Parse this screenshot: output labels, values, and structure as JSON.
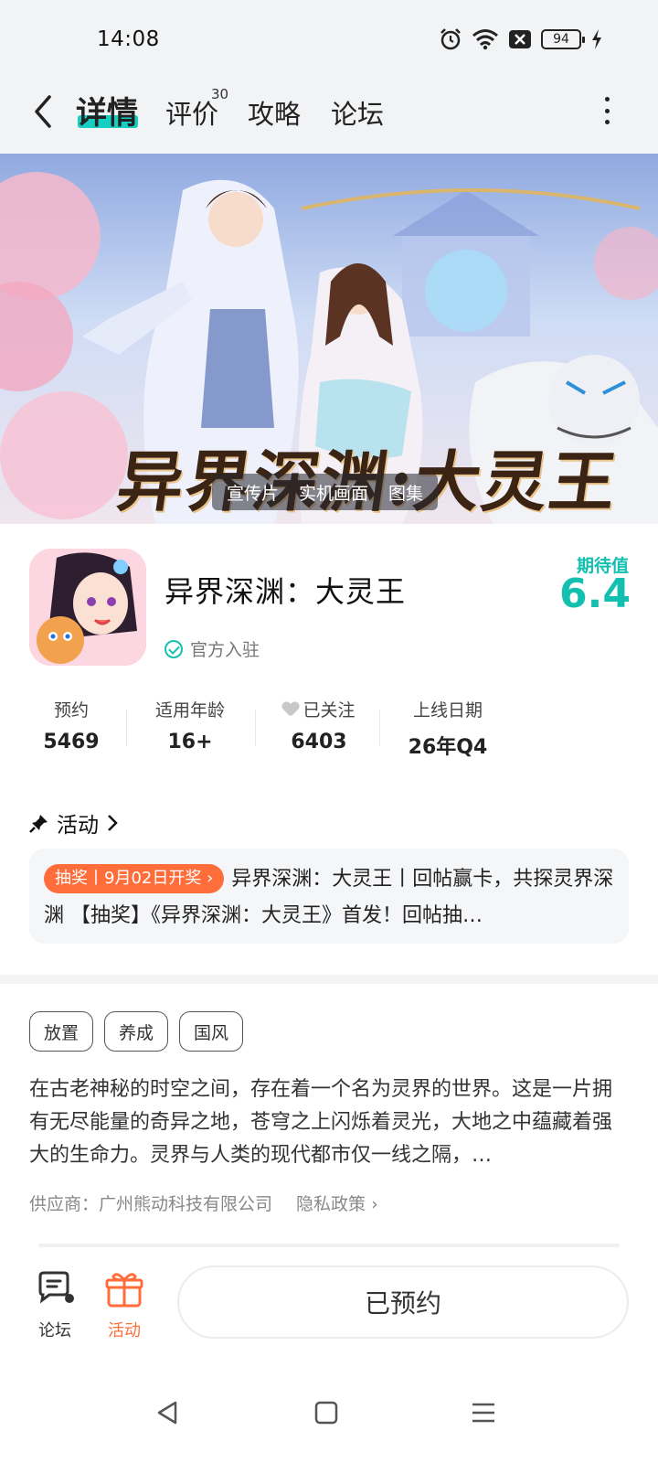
{
  "status_bar": {
    "time": "14:08",
    "battery": "94"
  },
  "nav": {
    "tabs": [
      {
        "label": "详情"
      },
      {
        "label": "评价",
        "badge": "30"
      },
      {
        "label": "攻略"
      },
      {
        "label": "论坛"
      }
    ]
  },
  "banner": {
    "title": "异界深渊:大灵王",
    "media_tabs": [
      "宣传片",
      "实机画面",
      "图集"
    ]
  },
  "app": {
    "name": "异界深渊：大灵王",
    "official": "官方入驻",
    "expect_label": "期待值",
    "expect_value": "6.4"
  },
  "stats": [
    {
      "label": "预约",
      "value": "5469"
    },
    {
      "label": "适用年龄",
      "value": "16+"
    },
    {
      "label": "已关注",
      "value": "6403"
    },
    {
      "label": "上线日期",
      "value": "26年Q4"
    }
  ],
  "activity": {
    "header": "活动",
    "tag": "抽奖丨9月02日开奖",
    "text": "异界深渊：大灵王丨回帖赢卡，共探灵界深渊 【抽奖】《异界深渊：大灵王》首发！回帖抽…"
  },
  "tags": [
    "放置",
    "养成",
    "国风"
  ],
  "description": "在古老神秘的时空之间，存在着一个名为灵界的世界。这是一片拥有无尽能量的奇异之地，苍穹之上闪烁着灵光，大地之中蕴藏着强大的生命力。灵界与人类的现代都市仅一线之隔，…",
  "provider": {
    "label": "供应商：广州熊动科技有限公司",
    "privacy": "隐私政策"
  },
  "bottom_bar": {
    "forum": "论坛",
    "activity": "活动",
    "reserve": "已预约"
  },
  "colors": {
    "accent": "#15d0c2",
    "orange": "#ff6d3a"
  }
}
